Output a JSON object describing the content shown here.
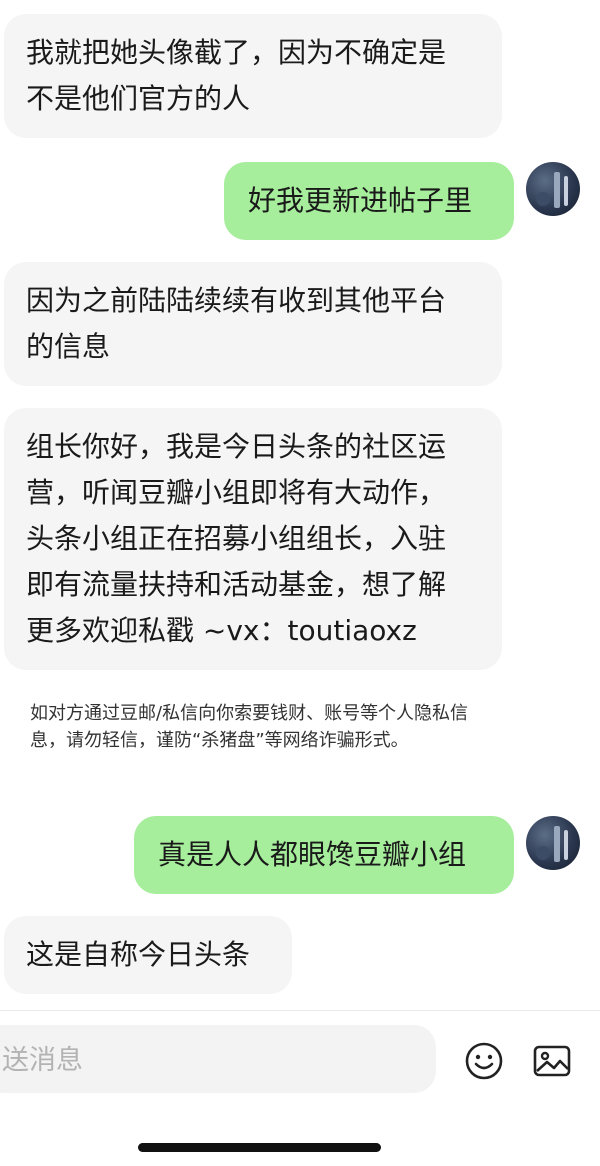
{
  "messages": [
    {
      "side": "in",
      "text": "我就把她头像截了，因为不确定是\n不是他们官方的人"
    },
    {
      "side": "out",
      "text": "好我更新进帖子里"
    },
    {
      "side": "in",
      "text": "因为之前陆陆续续有收到其他平台\n的信息"
    },
    {
      "side": "in",
      "text": "组长你好，我是今日头条的社区运\n营，听闻豆瓣小组即将有大动作，\n头条小组正在招募小组组长，入驻\n即有流量扶持和活动基金，想了解\n更多欢迎私戳 ~vx：toutiaoxz"
    },
    {
      "side": "out",
      "text": "真是人人都眼馋豆瓣小组"
    },
    {
      "side": "in",
      "text": "这是自称今日头条"
    }
  ],
  "warning": "如对方通过豆邮/私信向你索要钱财、账号等个人隐私信息，请勿轻信，谨防“杀猪盘”等网络诈骗形式。",
  "composer": {
    "placeholder": "送消息"
  },
  "icons": {
    "emoji": "emoji-icon",
    "image": "image-icon"
  },
  "colors": {
    "incoming_bubble": "#f5f5f5",
    "outgoing_bubble": "#a6ee9c"
  }
}
